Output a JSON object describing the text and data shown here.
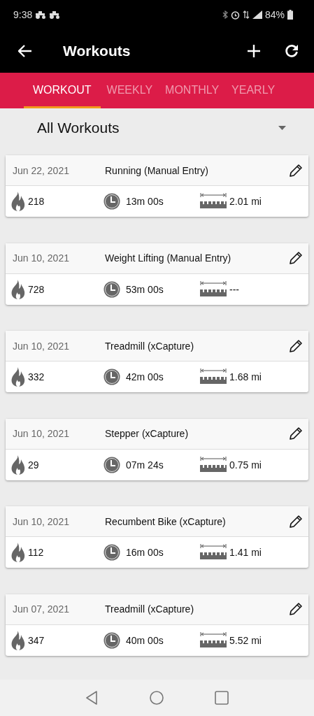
{
  "status_bar": {
    "time": "9:38",
    "battery": "84%"
  },
  "app_bar": {
    "title": "Workouts"
  },
  "tabs": [
    {
      "label": "WORKOUT",
      "selected": true
    },
    {
      "label": "WEEKLY",
      "selected": false
    },
    {
      "label": "MONTHLY",
      "selected": false
    },
    {
      "label": "YEARLY",
      "selected": false
    }
  ],
  "filter": {
    "value": "All Workouts"
  },
  "workouts": [
    {
      "date": "Jun 22, 2021",
      "name": "Running (Manual Entry)",
      "calories": "218",
      "duration": "13m 00s",
      "distance": "2.01 mi"
    },
    {
      "date": "Jun 10, 2021",
      "name": "Weight Lifting (Manual Entry)",
      "calories": "728",
      "duration": "53m 00s",
      "distance": "---"
    },
    {
      "date": "Jun 10, 2021",
      "name": "Treadmill (xCapture)",
      "calories": "332",
      "duration": "42m 00s",
      "distance": "1.68 mi"
    },
    {
      "date": "Jun 10, 2021",
      "name": "Stepper (xCapture)",
      "calories": "29",
      "duration": "07m 24s",
      "distance": "0.75 mi"
    },
    {
      "date": "Jun 10, 2021",
      "name": "Recumbent Bike (xCapture)",
      "calories": "112",
      "duration": "16m 00s",
      "distance": "1.41 mi"
    },
    {
      "date": "Jun 07, 2021",
      "name": "Treadmill (xCapture)",
      "calories": "347",
      "duration": "40m 00s",
      "distance": "5.52 mi"
    }
  ]
}
